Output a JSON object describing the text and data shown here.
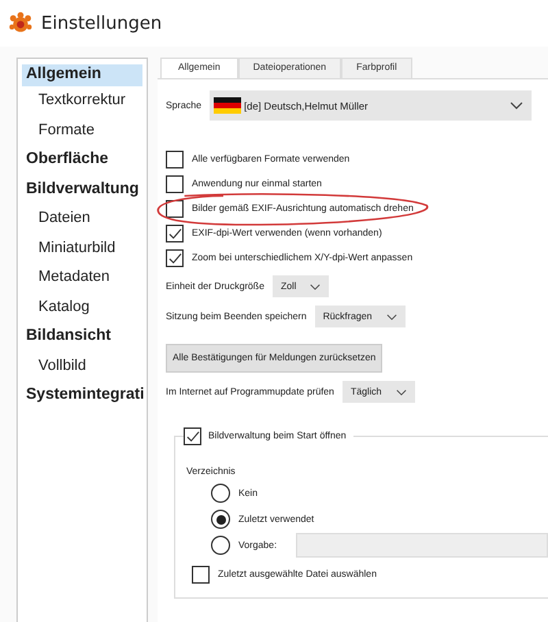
{
  "window": {
    "title": "Einstellungen"
  },
  "sidebar": {
    "items": [
      {
        "label": "Allgemein",
        "selected": true,
        "children": [
          {
            "label": "Textkorrektur",
            "selected": false
          },
          {
            "label": "Formate",
            "selected": false
          }
        ]
      },
      {
        "label": "Oberfläche",
        "selected": false
      },
      {
        "label": "Bildverwaltung",
        "selected": false,
        "children": [
          {
            "label": "Dateien",
            "selected": false
          },
          {
            "label": "Miniaturbild",
            "selected": false
          },
          {
            "label": "Metadaten",
            "selected": false
          },
          {
            "label": "Katalog",
            "selected": false
          }
        ]
      },
      {
        "label": "Bildansicht",
        "selected": false,
        "children": [
          {
            "label": "Vollbild",
            "selected": false
          }
        ]
      },
      {
        "label": "Systemintegrati",
        "selected": false
      }
    ]
  },
  "tabs": [
    {
      "label": "Allgemein",
      "selected": true
    },
    {
      "label": "Dateioperationen",
      "selected": false
    },
    {
      "label": "Farbprofil",
      "selected": false
    }
  ],
  "language": {
    "label": "Sprache",
    "value": "[de] Deutsch,Helmut Müller"
  },
  "checkboxes": [
    {
      "label": "Alle verfügbaren Formate verwenden",
      "checked": false,
      "circled": false
    },
    {
      "label": "Anwendung nur einmal starten",
      "checked": false,
      "circled": false
    },
    {
      "label": "Bilder gemäß EXIF-Ausrichtung automatisch drehen",
      "checked": false,
      "circled": true
    },
    {
      "label": "EXIF-dpi-Wert verwenden (wenn vorhanden)",
      "checked": true,
      "circled": false
    },
    {
      "label": "Zoom bei unterschiedlichem X/Y-dpi-Wert anpassen",
      "checked": true,
      "circled": false
    }
  ],
  "settings": [
    {
      "kind": "select",
      "label": "Einheit der Druckgröße",
      "value": "Zoll"
    },
    {
      "kind": "select",
      "label": "Sitzung beim Beenden speichern",
      "value": "Rückfragen"
    },
    {
      "kind": "button",
      "label": "Alle Bestätigungen für Meldungen zurücksetzen"
    },
    {
      "kind": "select",
      "label": "Im Internet auf Programmupdate prüfen",
      "value": "Täglich"
    }
  ],
  "group": {
    "label": "Bildverwaltung beim Start öffnen",
    "checked": true,
    "directory_label": "Verzeichnis",
    "radios": [
      {
        "label": "Kein",
        "selected": false,
        "field": false
      },
      {
        "label": "Zuletzt verwendet",
        "selected": true,
        "field": false
      },
      {
        "label": "Vorgabe:",
        "selected": false,
        "field": true
      }
    ],
    "last_file": {
      "label": "Zuletzt ausgewählte Datei auswählen",
      "checked": false
    }
  }
}
